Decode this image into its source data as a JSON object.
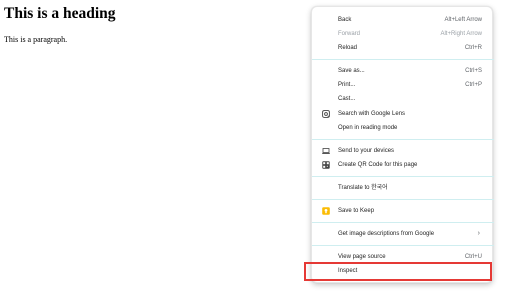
{
  "page": {
    "heading": "This is a heading",
    "paragraph": "This is a paragraph."
  },
  "context_menu": {
    "items": [
      {
        "label": "Back",
        "shortcut": "Alt+Left Arrow"
      },
      {
        "label": "Forward",
        "shortcut": "Alt+Right Arrow",
        "disabled": true
      },
      {
        "label": "Reload",
        "shortcut": "Ctrl+R"
      },
      {
        "label": "Save as...",
        "shortcut": "Ctrl+S"
      },
      {
        "label": "Print...",
        "shortcut": "Ctrl+P"
      },
      {
        "label": "Cast..."
      },
      {
        "label": "Search with Google Lens",
        "icon": "google-lens-icon"
      },
      {
        "label": "Open in reading mode"
      },
      {
        "label": "Send to your devices",
        "icon": "laptop-icon"
      },
      {
        "label": "Create QR Code for this page",
        "icon": "qr-code-icon"
      },
      {
        "label": "Translate to 한국어"
      },
      {
        "label": "Save to Keep",
        "icon": "keep-icon"
      },
      {
        "label": "Get image descriptions from Google",
        "submenu": "›"
      },
      {
        "label": "View page source",
        "shortcut": "Ctrl+U"
      },
      {
        "label": "Inspect"
      }
    ]
  },
  "colors": {
    "highlight_border": "#e53935",
    "keep_icon": "#fbbc04",
    "divider": "#cfeef0"
  }
}
